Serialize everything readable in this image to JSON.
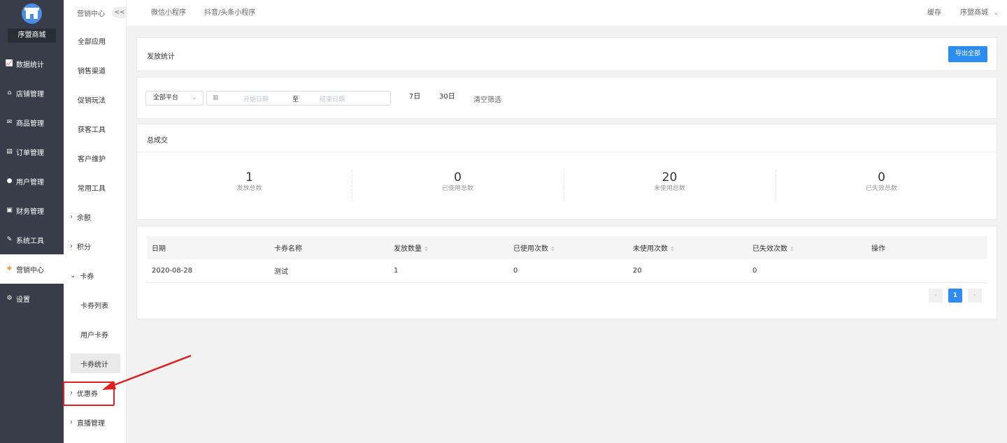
{
  "sidebar": {
    "store_name": "序盟商城",
    "items": [
      {
        "label": "数据统计",
        "icon": "chart-icon"
      },
      {
        "label": "店铺管理",
        "icon": "store-icon"
      },
      {
        "label": "商品管理",
        "icon": "goods-icon"
      },
      {
        "label": "订单管理",
        "icon": "order-icon"
      },
      {
        "label": "用户管理",
        "icon": "user-icon"
      },
      {
        "label": "财务管理",
        "icon": "finance-icon"
      },
      {
        "label": "系统工具",
        "icon": "wrench-icon"
      },
      {
        "label": "营销中心",
        "icon": "marketing-icon",
        "active": true
      },
      {
        "label": "设置",
        "icon": "gear-icon"
      }
    ]
  },
  "submenu": {
    "title": "营销中心",
    "collapse": "<<",
    "items": {
      "all_apps": "全部应用",
      "sales_channel": "销售渠道",
      "promotion": "促销玩法",
      "acquire_tools": "获客工具",
      "customer_care": "客户维护",
      "common_tools": "常用工具",
      "balance": "余额",
      "points": "积分",
      "card": "卡券",
      "card_list": "卡券列表",
      "user_card": "用户卡券",
      "card_stats": "卡券统计",
      "coupon": "优惠券",
      "live": "直播管理"
    }
  },
  "topbar": {
    "tabs": [
      "微信小程序",
      "抖音/头条小程序"
    ],
    "cache": "缓存",
    "store": "序盟商城"
  },
  "header_card": {
    "title": "发放统计",
    "export_button": "导出全部"
  },
  "filters": {
    "platform": "全部平台",
    "start_placeholder": "开始日期",
    "to": "至",
    "end_placeholder": "结束日期",
    "days7": "7日",
    "days30": "30日",
    "clear": "清空筛选"
  },
  "summary": {
    "title": "总成交",
    "stats": [
      {
        "value": "1",
        "label": "发放总数"
      },
      {
        "value": "0",
        "label": "已使用总数"
      },
      {
        "value": "20",
        "label": "未使用总数"
      },
      {
        "value": "0",
        "label": "已失效总数"
      }
    ]
  },
  "table": {
    "columns": [
      "日期",
      "卡券名称",
      "发放数量",
      "已使用次数",
      "未使用次数",
      "已失效次数",
      "操作"
    ],
    "rows": [
      [
        "2020-08-28",
        "测试",
        "1",
        "0",
        "20",
        "0",
        ""
      ]
    ]
  },
  "pagination": {
    "current": "1",
    "prev": "‹",
    "next": "›"
  },
  "colors": {
    "sidebar_bg": "#393d49",
    "primary": "#2d8cf0",
    "highlight": "#e02020"
  }
}
